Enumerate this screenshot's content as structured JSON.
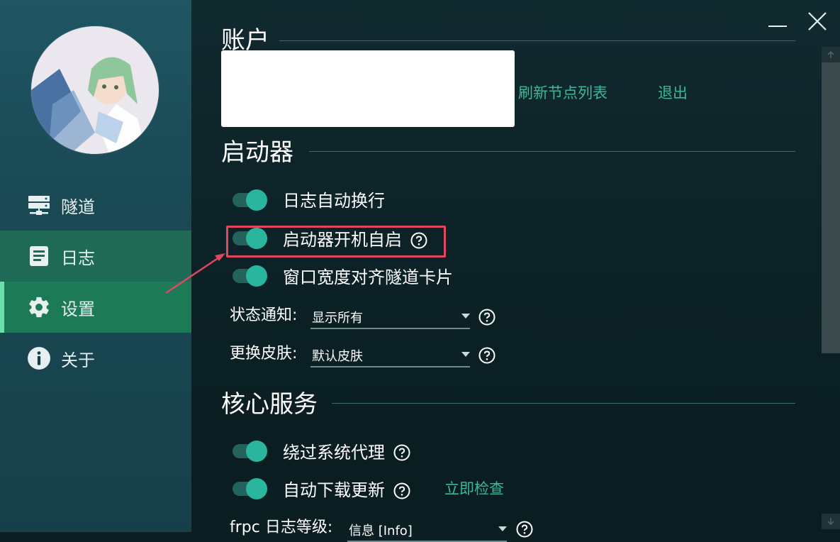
{
  "sidebar": {
    "nav_items": [
      {
        "label": "隧道",
        "icon": "server-icon"
      },
      {
        "label": "日志",
        "icon": "log-icon"
      },
      {
        "label": "设置",
        "icon": "gear-icon"
      },
      {
        "label": "关于",
        "icon": "info-icon"
      }
    ],
    "active_item": "设置"
  },
  "account": {
    "title": "账户",
    "refresh_label": "刷新节点列表",
    "logout_label": "退出"
  },
  "launcher": {
    "title": "启动器",
    "options": [
      {
        "label": "日志自动换行",
        "enabled": true
      },
      {
        "label": "启动器开机自启",
        "enabled": true,
        "help": true
      },
      {
        "label": "窗口宽度对齐隧道卡片",
        "enabled": true
      }
    ],
    "status_notify": {
      "label": "状态通知:",
      "value": "显示所有"
    },
    "skin": {
      "label": "更换皮肤:",
      "value": "默认皮肤"
    }
  },
  "core": {
    "title": "核心服务",
    "options": [
      {
        "label": "绕过系统代理",
        "enabled": true,
        "help": true
      },
      {
        "label": "自动下载更新",
        "enabled": true,
        "help": true
      }
    ],
    "check_now_label": "立即检查",
    "log_level": {
      "label": "frpc 日志等级:",
      "value": "信息 [Info]"
    }
  },
  "colors": {
    "accent": "#2ab59e",
    "link": "#3bb89c",
    "active_nav": "#1d7a57",
    "highlight": "#e2475f"
  }
}
